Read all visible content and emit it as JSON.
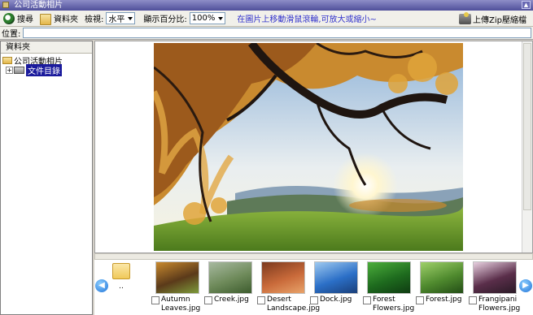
{
  "window": {
    "title": "公司活動相片"
  },
  "toolbar": {
    "search_label": "搜尋",
    "folders_label": "資料夾",
    "view_label": "檢視:",
    "view_value": "水平",
    "zoom_label": "顯示百分比:",
    "zoom_value": "100%",
    "hint": "在圖片上移動滑鼠滾輪,可放大或縮小~",
    "upload_label": "上傳Zip壓縮檔"
  },
  "address": {
    "label": "位置:",
    "value": ""
  },
  "sidebar": {
    "header": "資料夾",
    "tree": [
      {
        "label": "公司活動相片"
      },
      {
        "label": "文件目錄",
        "selected": true
      }
    ]
  },
  "filmstrip": {
    "up_label": "..",
    "items": [
      {
        "name": "Autumn Leaves.jpg",
        "colors": [
          "#5b3a1a",
          "#c98a2f",
          "#7c9a3a"
        ]
      },
      {
        "name": "Creek.jpg",
        "colors": [
          "#6e8a5a",
          "#a7b9a0",
          "#3d5c2e"
        ]
      },
      {
        "name": "Desert Landscape.jpg",
        "colors": [
          "#c96a3a",
          "#7c3a1e",
          "#e8a36a"
        ]
      },
      {
        "name": "Dock.jpg",
        "colors": [
          "#2b6fc7",
          "#9fcaf0",
          "#1a3f7a"
        ]
      },
      {
        "name": "Forest Flowers.jpg",
        "colors": [
          "#1e6b1e",
          "#4cae3c",
          "#0f3c12"
        ]
      },
      {
        "name": "Forest.jpg",
        "colors": [
          "#4f8a2e",
          "#9fd06a",
          "#234d16"
        ]
      },
      {
        "name": "Frangipani Flowers.jpg",
        "colors": [
          "#5a2e4a",
          "#e8d0e0",
          "#2a1a26"
        ]
      }
    ]
  }
}
